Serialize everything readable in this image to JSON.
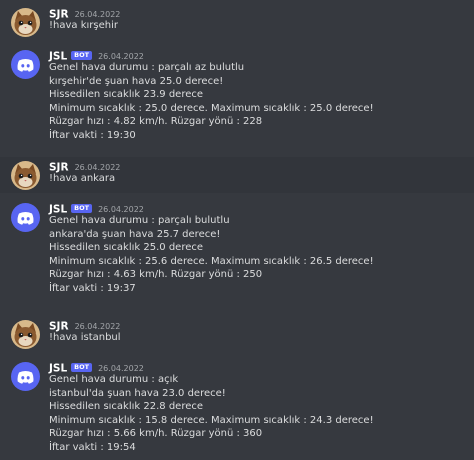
{
  "messages": [
    {
      "author": "SJR",
      "is_bot": false,
      "timestamp": "26.04.2022",
      "avatar_icon": "cat-avatar-icon",
      "lines": [
        "!hava kırşehir"
      ]
    },
    {
      "author": "JSL",
      "is_bot": true,
      "bot_tag": "BOT",
      "timestamp": "26.04.2022",
      "avatar_icon": "discord-logo-icon",
      "lines": [
        "Genel hava durumu : parçalı az bulutlu",
        "kırşehir'de şuan hava 25.0 derece!",
        "Hissedilen sıcaklık 23.9 derece",
        "Minimum sıcaklık : 25.0 derece. Maximum sıcaklık : 25.0 derece!",
        "Rüzgar hızı : 4.82 km/h. Rüzgar yönü : 228",
        "İftar vakti : 19:30"
      ]
    },
    {
      "author": "SJR",
      "is_bot": false,
      "timestamp": "26.04.2022",
      "avatar_icon": "cat-avatar-icon",
      "lines": [
        "!hava ankara"
      ]
    },
    {
      "author": "JSL",
      "is_bot": true,
      "bot_tag": "BOT",
      "timestamp": "26.04.2022",
      "avatar_icon": "discord-logo-icon",
      "lines": [
        "Genel hava durumu : parçalı bulutlu",
        "ankara'da şuan hava 25.7 derece!",
        "Hissedilen sıcaklık 25.0 derece",
        "Minimum sıcaklık : 25.6 derece. Maximum sıcaklık : 26.5 derece!",
        "Rüzgar hızı : 4.63 km/h. Rüzgar yönü : 250",
        "İftar vakti : 19:37"
      ]
    },
    {
      "author": "SJR",
      "is_bot": false,
      "timestamp": "26.04.2022",
      "avatar_icon": "cat-avatar-icon",
      "lines": [
        "!hava istanbul"
      ]
    },
    {
      "author": "JSL",
      "is_bot": true,
      "bot_tag": "BOT",
      "timestamp": "26.04.2022",
      "avatar_icon": "discord-logo-icon",
      "lines": [
        "Genel hava durumu : açık",
        "istanbul'da şuan hava 23.0 derece!",
        "Hissedilen sıcaklık 22.8 derece",
        "Minimum sıcaklık : 15.8 derece. Maximum sıcaklık : 24.3 derece!",
        "Rüzgar hızı : 5.66 km/h. Rüzgar yönü : 360",
        "İftar vakti : 19:54"
      ]
    }
  ],
  "colors": {
    "background": "#36393f",
    "highlight": "#32353b",
    "bot_tag": "#5865f2",
    "discord_blurple": "#5865f2",
    "author": "#ffffff",
    "timestamp": "#a3a6aa",
    "text": "#dcddde"
  }
}
